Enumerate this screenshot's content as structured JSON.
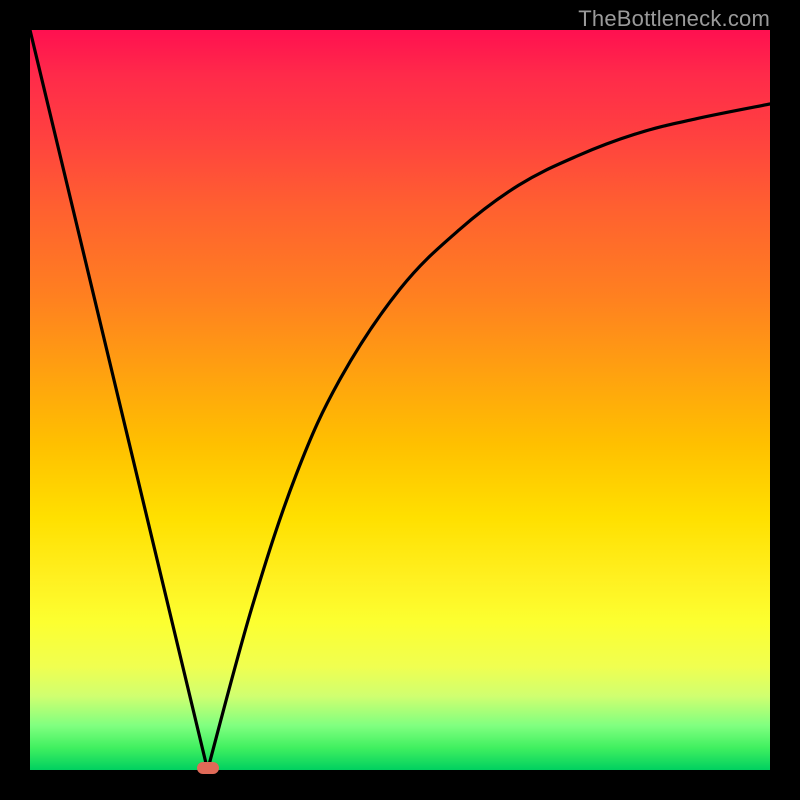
{
  "watermark": "TheBottleneck.com",
  "colors": {
    "background": "#000000",
    "curve": "#000000",
    "marker": "#e06a58",
    "gradient_top": "#ff1050",
    "gradient_bottom": "#00d060"
  },
  "chart_data": {
    "type": "line",
    "title": "",
    "xlabel": "",
    "ylabel": "",
    "xlim": [
      0,
      100
    ],
    "ylim": [
      0,
      100
    ],
    "grid": false,
    "legend": false,
    "axes_visible": false,
    "background_gradient": "rainbow-vertical (red→yellow→green)",
    "series": [
      {
        "name": "left-segment",
        "description": "Steep straight descent from top-left to the minimum",
        "x": [
          0,
          24
        ],
        "y": [
          100,
          0
        ]
      },
      {
        "name": "right-segment",
        "description": "Concave curve rising from the minimum toward upper-right, flattening",
        "x": [
          24,
          30,
          36,
          42,
          50,
          58,
          66,
          74,
          82,
          90,
          100
        ],
        "y": [
          0,
          22,
          40,
          53,
          65,
          73,
          79,
          83,
          86,
          88,
          90
        ]
      }
    ],
    "marker": {
      "name": "optimal-point",
      "x": 24,
      "y": 0,
      "shape": "rounded-rect"
    }
  }
}
